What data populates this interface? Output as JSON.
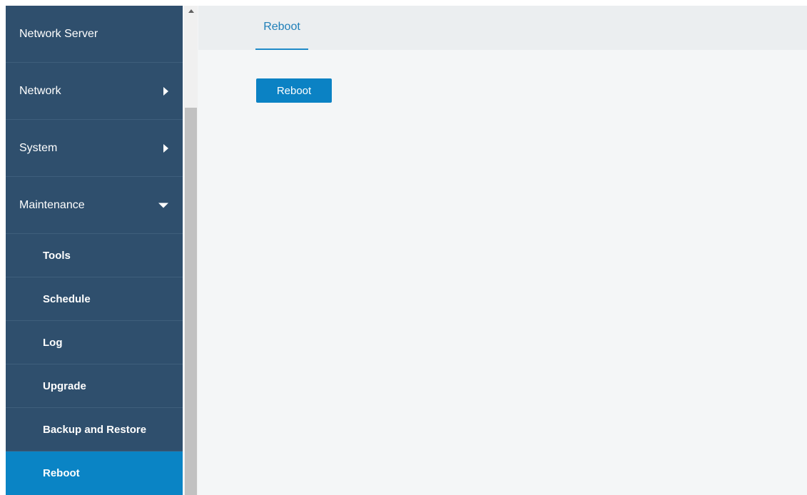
{
  "sidebar": {
    "items": [
      {
        "label": "Network Server",
        "icon": "none"
      },
      {
        "label": "Network",
        "icon": "caret-right-icon"
      },
      {
        "label": "System",
        "icon": "caret-right-icon"
      },
      {
        "label": "Maintenance",
        "icon": "caret-down-icon",
        "expanded": true
      }
    ],
    "subitems": [
      {
        "label": "Tools"
      },
      {
        "label": "Schedule"
      },
      {
        "label": "Log"
      },
      {
        "label": "Upgrade"
      },
      {
        "label": "Backup and Restore"
      },
      {
        "label": "Reboot",
        "active": true
      }
    ]
  },
  "tabs": [
    {
      "label": "Reboot",
      "active": true
    }
  ],
  "main": {
    "reboot_button_label": "Reboot"
  },
  "colors": {
    "sidebar_bg": "#2f4f6d",
    "active_item_bg": "#0a84c5",
    "accent": "#1f7fb8",
    "button_bg": "#0b82c4",
    "content_bg": "#f4f6f7"
  }
}
